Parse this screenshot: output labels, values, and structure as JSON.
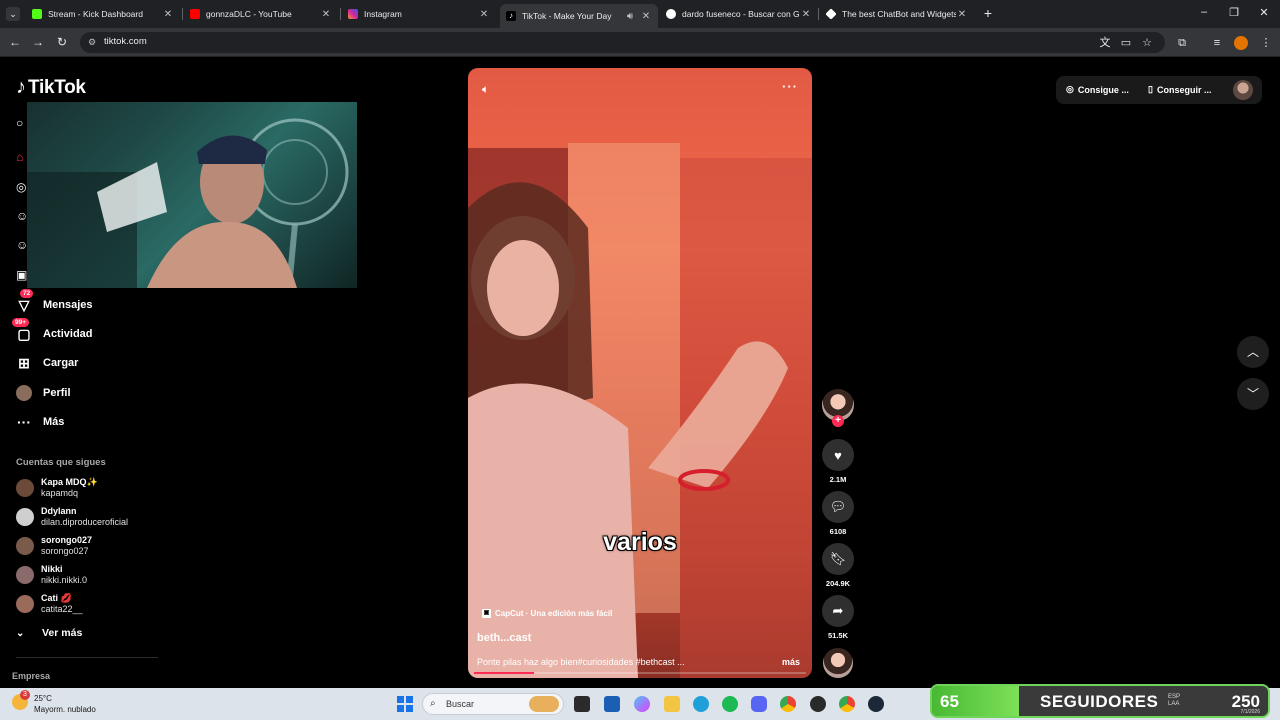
{
  "browser": {
    "tabs": [
      {
        "title": "Stream - Kick Dashboard",
        "fav_color": "#53fc18",
        "active": false
      },
      {
        "title": "gonnzaDLC - YouTube",
        "fav_color": "#ff0000",
        "active": false
      },
      {
        "title": "Instagram",
        "fav_color": "#d6249f",
        "active": false
      },
      {
        "title": "TikTok - Make Your Day",
        "fav_color": "#ffffff",
        "active": true
      },
      {
        "title": "dardo fuseneco - Buscar con Google",
        "fav_color": "#4285f4",
        "active": false
      },
      {
        "title": "The best ChatBot and Widgets",
        "fav_color": "#ffffff",
        "active": false
      }
    ],
    "url": "tiktok.com"
  },
  "sidebar": {
    "logo": "TikTok",
    "items": [
      {
        "label": "Mensajes",
        "badge": "72"
      },
      {
        "label": "Actividad",
        "badge": "99+"
      },
      {
        "label": "Cargar",
        "badge": ""
      },
      {
        "label": "Perfil",
        "badge": ""
      },
      {
        "label": "Más",
        "badge": ""
      }
    ],
    "following_title": "Cuentas que sigues",
    "following": [
      {
        "name": "Kapa MDQ✨",
        "handle": "kapamdq",
        "color": "#6b4a3a"
      },
      {
        "name": "Ddylann",
        "handle": "dilan.diproduceroficial",
        "color": "#cfcfcf"
      },
      {
        "name": "sorongo027",
        "handle": "sorongo027",
        "color": "#7a5a4a"
      },
      {
        "name": "Nikki",
        "handle": "nikki.nikki.0",
        "color": "#8a6a6a"
      },
      {
        "name": "Cati 💋",
        "handle": "catita22__",
        "color": "#9a6a5a"
      }
    ],
    "see_more": "Ver más",
    "company": "Empresa"
  },
  "video": {
    "caption_word": "varios",
    "capcut": "CapCut · Una edición más fácil",
    "author": "beth...cast",
    "description": "Ponte pilas haz algo bien#curiosidades #bethcast ...",
    "more": "más",
    "progress": 0.18
  },
  "actions": {
    "likes": "2.1M",
    "comments": "6108",
    "saves": "204.9K",
    "shares": "51.5K"
  },
  "topright": {
    "coins_label": "Consigue ...",
    "app_label": "Conseguir ..."
  },
  "taskbar": {
    "temp": "25°C",
    "weather": "Mayorm. nublado",
    "weather_badge": "3",
    "search_placeholder": "Buscar"
  },
  "overlay": {
    "current": "65",
    "label": "SEGUIDORES",
    "target": "250",
    "progress": 0.26,
    "tray_lang": "ESP",
    "tray_layout": "LAA",
    "date": "7/1/2026"
  },
  "colors": {
    "accent": "#fe2c55",
    "goal_green": "#6fd45a"
  }
}
